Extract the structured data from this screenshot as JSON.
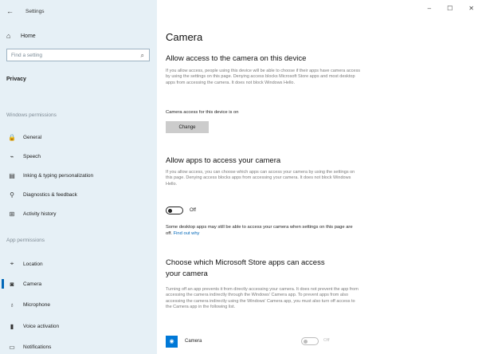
{
  "window": {
    "title": "Settings",
    "back_icon": "back-arrow-icon",
    "controls": {
      "minimize": "–",
      "maximize": "☐",
      "close": "✕"
    }
  },
  "sidebar": {
    "home": {
      "icon": "home-icon",
      "label": "Home"
    },
    "search": {
      "placeholder": "Find a setting",
      "icon": "search-icon"
    },
    "section_title": "Privacy",
    "windows_permissions": {
      "header": "Windows permissions",
      "items": [
        {
          "icon": "lock-icon",
          "label": "General"
        },
        {
          "icon": "speech-icon",
          "label": "Speech"
        },
        {
          "icon": "notebook-icon",
          "label": "Inking & typing personalization"
        },
        {
          "icon": "diagnostics-icon",
          "label": "Diagnostics & feedback"
        },
        {
          "icon": "activity-history-icon",
          "label": "Activity history"
        }
      ]
    },
    "app_permissions": {
      "header": "App permissions",
      "items": [
        {
          "icon": "location-icon",
          "label": "Location"
        },
        {
          "icon": "camera-icon",
          "label": "Camera",
          "active": true
        },
        {
          "icon": "microphone-icon",
          "label": "Microphone"
        },
        {
          "icon": "voice-activation-icon",
          "label": "Voice activation"
        },
        {
          "icon": "notifications-icon",
          "label": "Notifications"
        }
      ]
    }
  },
  "main": {
    "page_title": "Camera",
    "device_section": {
      "heading": "Allow access to the camera on this device",
      "description": "If you allow access, people using this device will be able to choose if their apps have camera access by using the settings on this page. Denying access blocks Microsoft Store apps and most desktop apps from accessing the camera. It does not block Windows Hello.",
      "status": "Camera access for this device is on",
      "change_button": "Change"
    },
    "apps_section": {
      "heading": "Allow apps to access your camera",
      "description": "If you allow access, you can choose which apps can access your camera by using the settings on this page. Denying access blocks apps from accessing your camera. It does not block Windows Hello.",
      "toggle_state": "Off",
      "note": "Some desktop apps may still be able to access your camera when settings on this page are off.",
      "note_link": "Find out why"
    },
    "store_apps_section": {
      "heading_line1": "Choose which Microsoft Store apps can access",
      "heading_line2": "your camera",
      "description": "Turning off an app prevents it from directly accessing your camera. It does not prevent the app from accessing the camera indirectly through the Windows' Camera app. To prevent apps from also accessing the camera indirectly using the Windows' Camera app, you must also turn off access to the Camera app in the following list.",
      "apps": [
        {
          "icon": "camera-app-icon",
          "name": "Camera",
          "toggle_state": "Off"
        }
      ]
    }
  }
}
